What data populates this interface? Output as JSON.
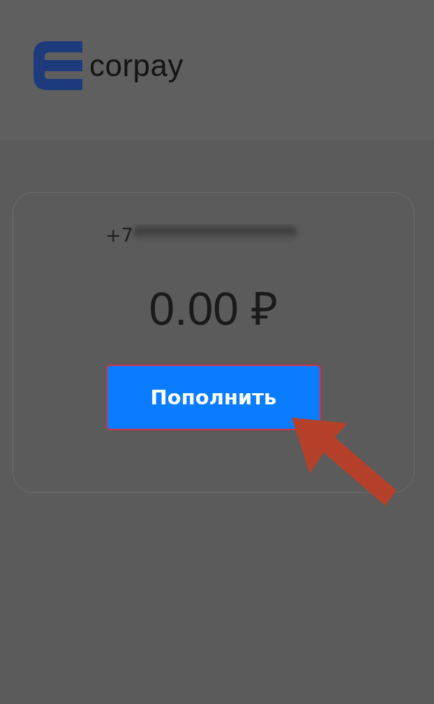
{
  "header": {
    "brand": "corpay"
  },
  "account": {
    "phone": "+7",
    "balance": "0.00 ₽",
    "button": "Пополнить",
    "button_highlighted": true
  }
}
